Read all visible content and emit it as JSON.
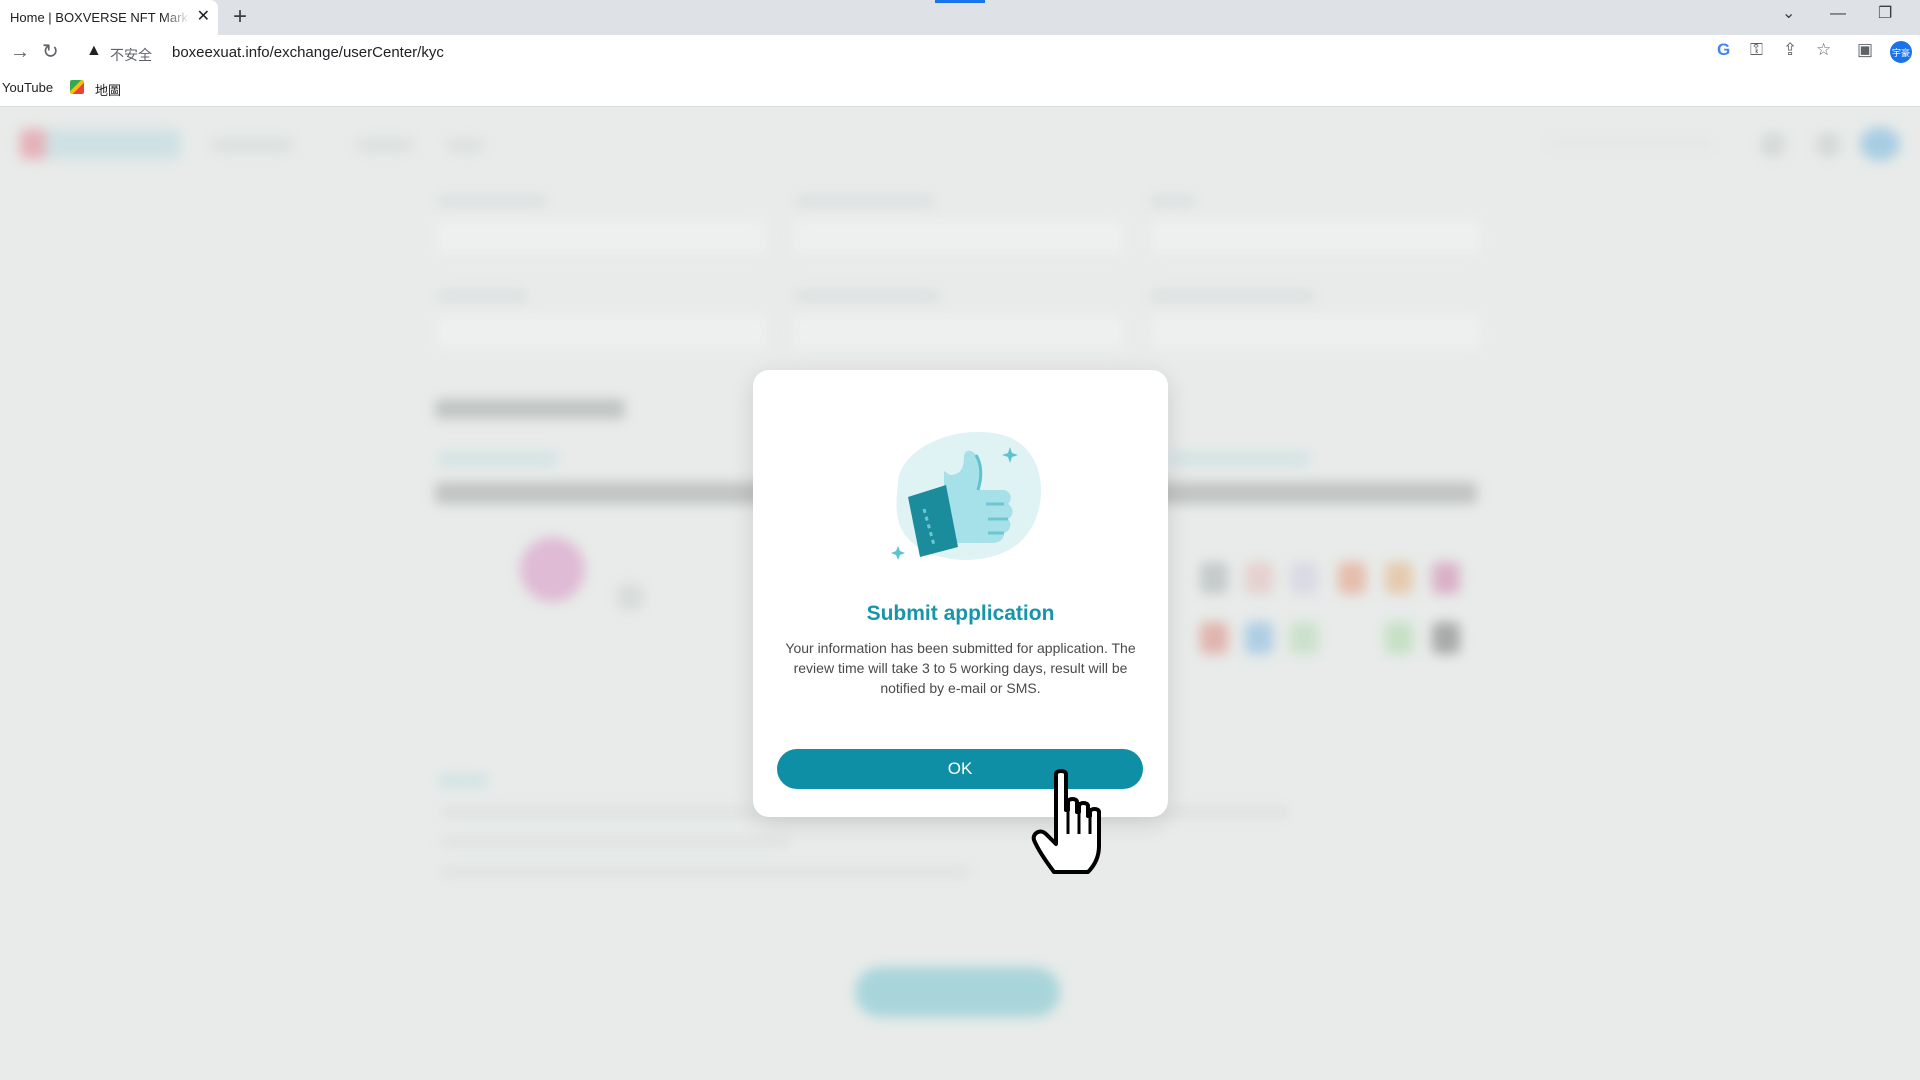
{
  "browser": {
    "tab_title": "Home | BOXVERSE NFT Market",
    "security_label": "不安全",
    "url": "boxeexuat.info/exchange/userCenter/kyc",
    "profile_initials": "宇豪",
    "bookmarks": [
      {
        "label": "YouTube"
      },
      {
        "label": "地圖"
      }
    ]
  },
  "modal": {
    "title": "Submit application",
    "message": "Your information has been submitted for application. The review time will take 3 to 5 working days, result will be notified by e-mail or SMS.",
    "ok_label": "OK",
    "illustration": "thumbs-up-icon"
  },
  "colors": {
    "accent": "#0f8fa6",
    "title": "#1795ab",
    "backdrop": "#eef0ef",
    "loadbar": "#1a73e8"
  }
}
